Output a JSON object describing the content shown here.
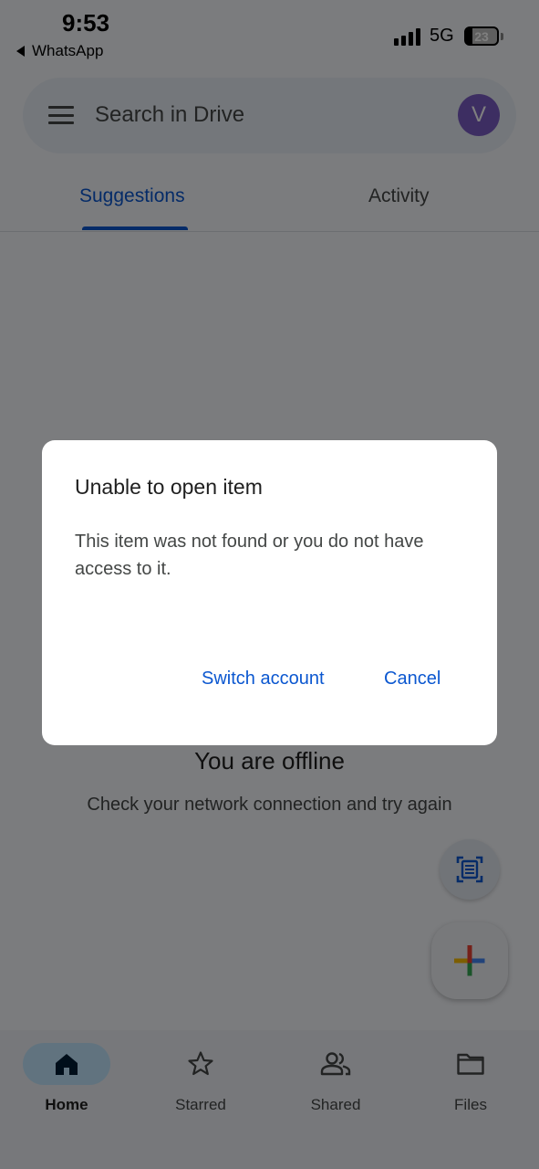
{
  "status_bar": {
    "time": "9:53",
    "back_app": "WhatsApp",
    "network": "5G",
    "battery": "23"
  },
  "search": {
    "placeholder": "Search in Drive",
    "avatar_letter": "V",
    "avatar_color": "#7b5cc4"
  },
  "tabs": [
    {
      "label": "Suggestions",
      "active": true
    },
    {
      "label": "Activity",
      "active": false
    }
  ],
  "offline": {
    "title": "You are offline",
    "subtitle": "Check your network connection and try again"
  },
  "dialog": {
    "title": "Unable to open item",
    "body": "This item was not found or you do not have access to it.",
    "buttons": {
      "switch_account": "Switch account",
      "cancel": "Cancel"
    }
  },
  "bottom_nav": [
    {
      "label": "Home",
      "icon": "home-icon",
      "active": true
    },
    {
      "label": "Starred",
      "icon": "star-icon",
      "active": false
    },
    {
      "label": "Shared",
      "icon": "shared-icon",
      "active": false
    },
    {
      "label": "Files",
      "icon": "folder-icon",
      "active": false
    }
  ],
  "colors": {
    "accent": "#0b57d0",
    "active_nav_pill": "#c2e7ff"
  }
}
